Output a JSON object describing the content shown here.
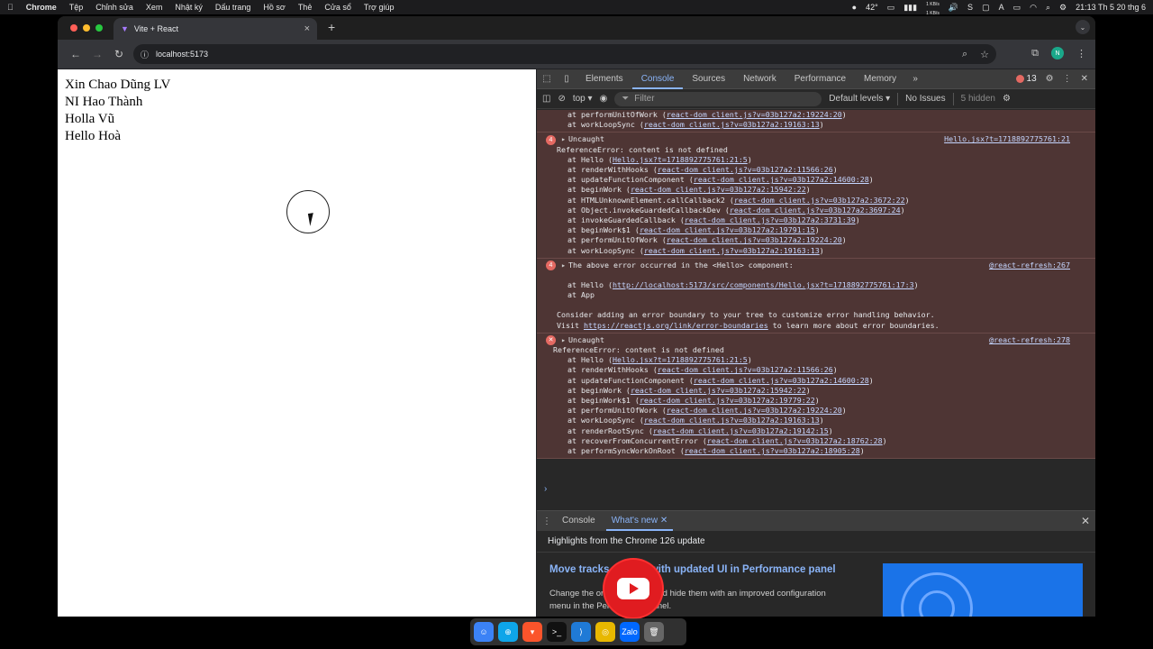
{
  "menubar": {
    "apple": "",
    "app": "Chrome",
    "items": [
      "Tệp",
      "Chỉnh sửa",
      "Xem",
      "Nhật ký",
      "Dấu trang",
      "Hồ sơ",
      "Thẻ",
      "Cửa sổ",
      "Trợ giúp"
    ],
    "weather": "42°",
    "net_up": "1 KB/s",
    "net_down": "1 KB/s",
    "clock": "21:13 Th 5 20 thg 6"
  },
  "browser": {
    "tab_title": "Vite + React",
    "new_tab": "+",
    "url": "localhost:5173",
    "profile_initial": "N"
  },
  "page": {
    "lines": [
      "Xin Chao Dũng LV",
      "NI Hao Thành",
      "Holla Vũ",
      "Hello Hoà"
    ]
  },
  "devtools": {
    "tabs": [
      "Elements",
      "Console",
      "Sources",
      "Network",
      "Performance",
      "Memory"
    ],
    "active_tab": "Console",
    "error_count": "13",
    "context": "top",
    "filter_placeholder": "Filter",
    "levels": "Default levels",
    "issues": "No Issues",
    "hidden": "5 hidden",
    "log": {
      "top_lines": [
        {
          "pre": "at performUnitOfWork (",
          "link": "react-dom_client.js?v=03b127a2:19224:20",
          "post": ")"
        },
        {
          "pre": "at workLoopSync (",
          "link": "react-dom_client.js?v=03b127a2:19163:13",
          "post": ")"
        }
      ],
      "e1": {
        "badge": "4",
        "head": "Uncaught",
        "source": "Hello.jsx?t=1718892775761:21",
        "msg": "ReferenceError: content is not defined",
        "frames": [
          {
            "pre": "at Hello (",
            "link": "Hello.jsx?t=1718892775761:21:5",
            "post": ")"
          },
          {
            "pre": "at renderWithHooks (",
            "link": "react-dom_client.js?v=03b127a2:11566:26",
            "post": ")"
          },
          {
            "pre": "at updateFunctionComponent (",
            "link": "react-dom_client.js?v=03b127a2:14600:28",
            "post": ")"
          },
          {
            "pre": "at beginWork (",
            "link": "react-dom_client.js?v=03b127a2:15942:22",
            "post": ")"
          },
          {
            "pre": "at HTMLUnknownElement.callCallback2 (",
            "link": "react-dom_client.js?v=03b127a2:3672:22",
            "post": ")"
          },
          {
            "pre": "at Object.invokeGuardedCallbackDev (",
            "link": "react-dom_client.js?v=03b127a2:3697:24",
            "post": ")"
          },
          {
            "pre": "at invokeGuardedCallback (",
            "link": "react-dom_client.js?v=03b127a2:3731:39",
            "post": ")"
          },
          {
            "pre": "at beginWork$1 (",
            "link": "react-dom_client.js?v=03b127a2:19791:15",
            "post": ")"
          },
          {
            "pre": "at performUnitOfWork (",
            "link": "react-dom_client.js?v=03b127a2:19224:20",
            "post": ")"
          },
          {
            "pre": "at workLoopSync (",
            "link": "react-dom_client.js?v=03b127a2:19163:13",
            "post": ")"
          }
        ]
      },
      "e2": {
        "badge": "4",
        "head": "The above error occurred in the <Hello> component:",
        "source": "@react-refresh:267",
        "frame1_pre": "at Hello (",
        "frame1_link": "http://localhost:5173/src/components/Hello.jsx?t=1718892775761:17:3",
        "frame1_post": ")",
        "frame2": "at App",
        "advice": "Consider adding an error boundary to your tree to customize error handling behavior.",
        "visit_pre": "Visit ",
        "visit_link": "https://reactjs.org/link/error-boundaries",
        "visit_post": " to learn more about error boundaries."
      },
      "e3": {
        "badge": "✕",
        "head": "Uncaught",
        "source": "@react-refresh:278",
        "msg": "ReferenceError: content is not defined",
        "frames": [
          {
            "pre": "at Hello (",
            "link": "Hello.jsx?t=1718892775761:21:5",
            "post": ")"
          },
          {
            "pre": "at renderWithHooks (",
            "link": "react-dom_client.js?v=03b127a2:11566:26",
            "post": ")"
          },
          {
            "pre": "at updateFunctionComponent (",
            "link": "react-dom_client.js?v=03b127a2:14600:28",
            "post": ")"
          },
          {
            "pre": "at beginWork (",
            "link": "react-dom_client.js?v=03b127a2:15942:22",
            "post": ")"
          },
          {
            "pre": "at beginWork$1 (",
            "link": "react-dom_client.js?v=03b127a2:19779:22",
            "post": ")"
          },
          {
            "pre": "at performUnitOfWork (",
            "link": "react-dom_client.js?v=03b127a2:19224:20",
            "post": ")"
          },
          {
            "pre": "at workLoopSync (",
            "link": "react-dom_client.js?v=03b127a2:19163:13",
            "post": ")"
          },
          {
            "pre": "at renderRootSync (",
            "link": "react-dom_client.js?v=03b127a2:19142:15",
            "post": ")"
          },
          {
            "pre": "at recoverFromConcurrentError (",
            "link": "react-dom_client.js?v=03b127a2:18762:28",
            "post": ")"
          },
          {
            "pre": "at performSyncWorkOnRoot (",
            "link": "react-dom_client.js?v=03b127a2:18905:28",
            "post": ")"
          }
        ]
      }
    },
    "drawer": {
      "tabs": [
        "Console",
        "What's new"
      ],
      "highlights": "Highlights from the Chrome 126 update",
      "feature_title": "Move tracks around with updated UI in Performance panel",
      "feature_text": "Change the order of tracks and hide them with an improved configuration menu in the Performance panel."
    }
  },
  "dock": {
    "apps": [
      "finder-icon",
      "safari-icon",
      "brave-icon",
      "terminal-icon",
      "vscode-icon",
      "chrome-icon",
      "zalo-icon",
      "trash-icon"
    ],
    "zalo_label": "Zalo"
  },
  "colors": {
    "error_bg": "#4e3534",
    "accent": "#8ab4f8",
    "error": "#e46962",
    "youtube": "#e01c20"
  }
}
